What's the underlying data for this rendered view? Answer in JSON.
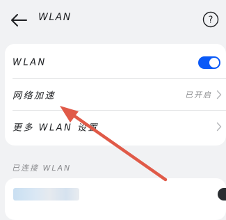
{
  "header": {
    "title": "WLAN",
    "back_icon": "arrow-left-icon",
    "help_icon": "question-circle-icon"
  },
  "settings": {
    "wlan": {
      "label": "WLAN",
      "toggle_on": true
    },
    "network_boost": {
      "label": "网络加速",
      "value": "已开启"
    },
    "more_settings": {
      "label": "更多 WLAN 设置"
    }
  },
  "connected_section": {
    "title": "已连接 WLAN"
  },
  "colors": {
    "toggle_on": "#0a59f7",
    "annotation_arrow": "#e05a48",
    "background": "#f1f2f4"
  }
}
